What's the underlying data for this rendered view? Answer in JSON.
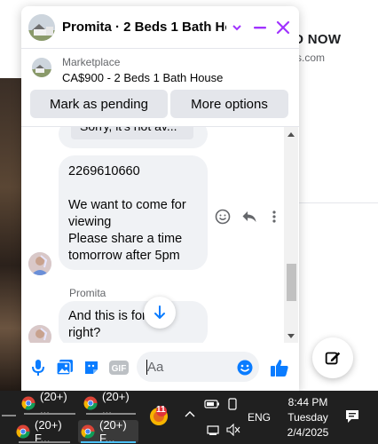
{
  "background_page": {
    "heading_fragment": "AD NOW",
    "sub_fragment": "s.com"
  },
  "chat": {
    "title": "Promita · 2 Beds 1 Bath Ho...",
    "listing": {
      "source": "Marketplace",
      "title": "CA$900 - 2 Beds 1 Bath House"
    },
    "buttons": {
      "pending": "Mark as pending",
      "more": "More options"
    },
    "messages": {
      "partial_top": "Sorry, it's not av...",
      "main": "2269610660\n\nWe want to come for viewing\nPlease share a time tomorrow after 5pm",
      "sender_name": "Promita",
      "last": "And this is for\nright?"
    },
    "composer": {
      "placeholder": "Aa",
      "gif_label": "GIF"
    }
  },
  "taskbar": {
    "items": [
      {
        "label": "(20+) ..."
      },
      {
        "label": "(20+) ..."
      },
      {
        "label": "(20+) F..."
      },
      {
        "label": "(20+) F..."
      }
    ],
    "notification_badge": "11",
    "language": "ENG",
    "time": "8:44 PM",
    "day": "Tuesday",
    "date": "2/4/2025"
  },
  "colors": {
    "messenger_purple": "#a033ff",
    "messenger_blue": "#0a7cff",
    "bubble_gray": "#f0f2f5"
  }
}
